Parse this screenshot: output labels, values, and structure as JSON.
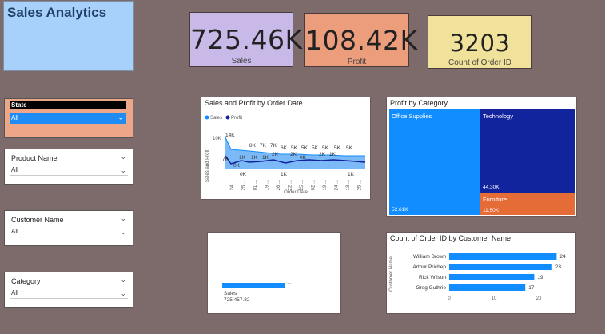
{
  "title": "Sales Analytics",
  "kpis": {
    "sales": {
      "value": "725.46K",
      "label": "Sales",
      "color": "#c9b9e9"
    },
    "profit": {
      "value": "108.42K",
      "label": "Profit",
      "color": "#ec9e7c"
    },
    "orders": {
      "value": "3203",
      "label": "Count of Order ID",
      "color": "#f0e29a"
    }
  },
  "slicers": {
    "state": {
      "header": "State",
      "value": "All"
    },
    "product": {
      "header": "Product Name",
      "value": "All"
    },
    "customer": {
      "header": "Customer Name",
      "value": "All"
    },
    "category": {
      "header": "Category",
      "value": "All"
    }
  },
  "line_chart": {
    "title": "Sales and Profit by Order Date",
    "legend": [
      "Sales",
      "Profit"
    ],
    "ylabel": "Sales and Profit",
    "xlabel": "Order Date",
    "ytick": "10K",
    "sales_labels": [
      "14K",
      "8K",
      "7K",
      "7K",
      "6K",
      "5K",
      "5K",
      "5K",
      "5K",
      "5K",
      "5K"
    ],
    "profit_labels": [
      "7K",
      "1K",
      "1K",
      "1K",
      "2K",
      "0K",
      "2K",
      "2K",
      "1K"
    ],
    "zero_labels": [
      "0K",
      "1K",
      "0K",
      "1K"
    ],
    "x_ticks": [
      "24 ...",
      "25 ...",
      "01 ...",
      "19 ...",
      "26 ...",
      "22 ...",
      "25 ...",
      "02 ...",
      "19 ...",
      "24 ...",
      "13 ...",
      "25 ..."
    ]
  },
  "treemap": {
    "title": "Profit by Category",
    "items": [
      {
        "name": "Office Supplies",
        "value": "52.61K"
      },
      {
        "name": "Technology",
        "value": "44.30K"
      },
      {
        "name": "Furniture",
        "value": "11.50K"
      }
    ]
  },
  "sales_bar": {
    "label": "Sales",
    "value": "725,457.82",
    "plus": "+"
  },
  "bar_chart": {
    "title": "Count of Order ID by Customer Name",
    "ylabel": "Customer Name",
    "customers": [
      "William Brown",
      "Arthur Prichep",
      "Rick Wilson",
      "Greg Guthrie"
    ],
    "counts": [
      24,
      23,
      19,
      17
    ],
    "x_ticks": [
      "0",
      "10",
      "20"
    ]
  },
  "chart_data": [
    {
      "type": "treemap",
      "title": "Profit by Category",
      "categories": [
        "Office Supplies",
        "Technology",
        "Furniture"
      ],
      "values": [
        52.61,
        44.3,
        11.5
      ]
    },
    {
      "type": "bar",
      "title": "Count of Order ID by Customer Name",
      "categories": [
        "William Brown",
        "Arthur Prichep",
        "Rick Wilson",
        "Greg Guthrie"
      ],
      "values": [
        24,
        23,
        19,
        17
      ],
      "xlabel": "",
      "ylabel": "Customer Name",
      "xlim": [
        0,
        25
      ]
    }
  ],
  "colors": {
    "blue": "#118dff",
    "navy": "#12239e",
    "orange": "#e66c37"
  }
}
